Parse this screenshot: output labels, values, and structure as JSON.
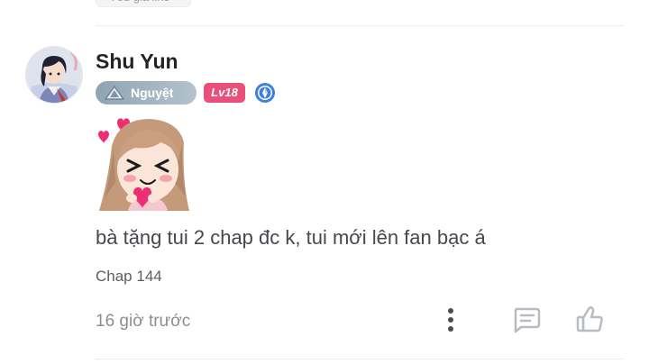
{
  "previous_comment": {
    "like_chip_label": "Yêu gia like"
  },
  "comment": {
    "username": "Shu Yun",
    "rank_label": "Nguyệt",
    "level_label": "Lv18",
    "text": "bà tặng tui 2 chap đc k, tui mới lên fan bạc á",
    "chapter": "Chap 144",
    "time_ago": "16 giờ trước",
    "icons": {
      "avatar": "anime-avatar",
      "rank": "triangle-rank-icon",
      "verified": "verified-icon",
      "sticker": "anime-girl-hearts-sticker",
      "more": "more-vertical-icon",
      "reply": "reply-icon",
      "like": "thumbs-up-icon"
    }
  },
  "colors": {
    "level_badge": "#ea4f7a",
    "rank_badge": "#9fb2bf",
    "icon_gray": "#b8bbc0",
    "text_primary": "#222426"
  }
}
